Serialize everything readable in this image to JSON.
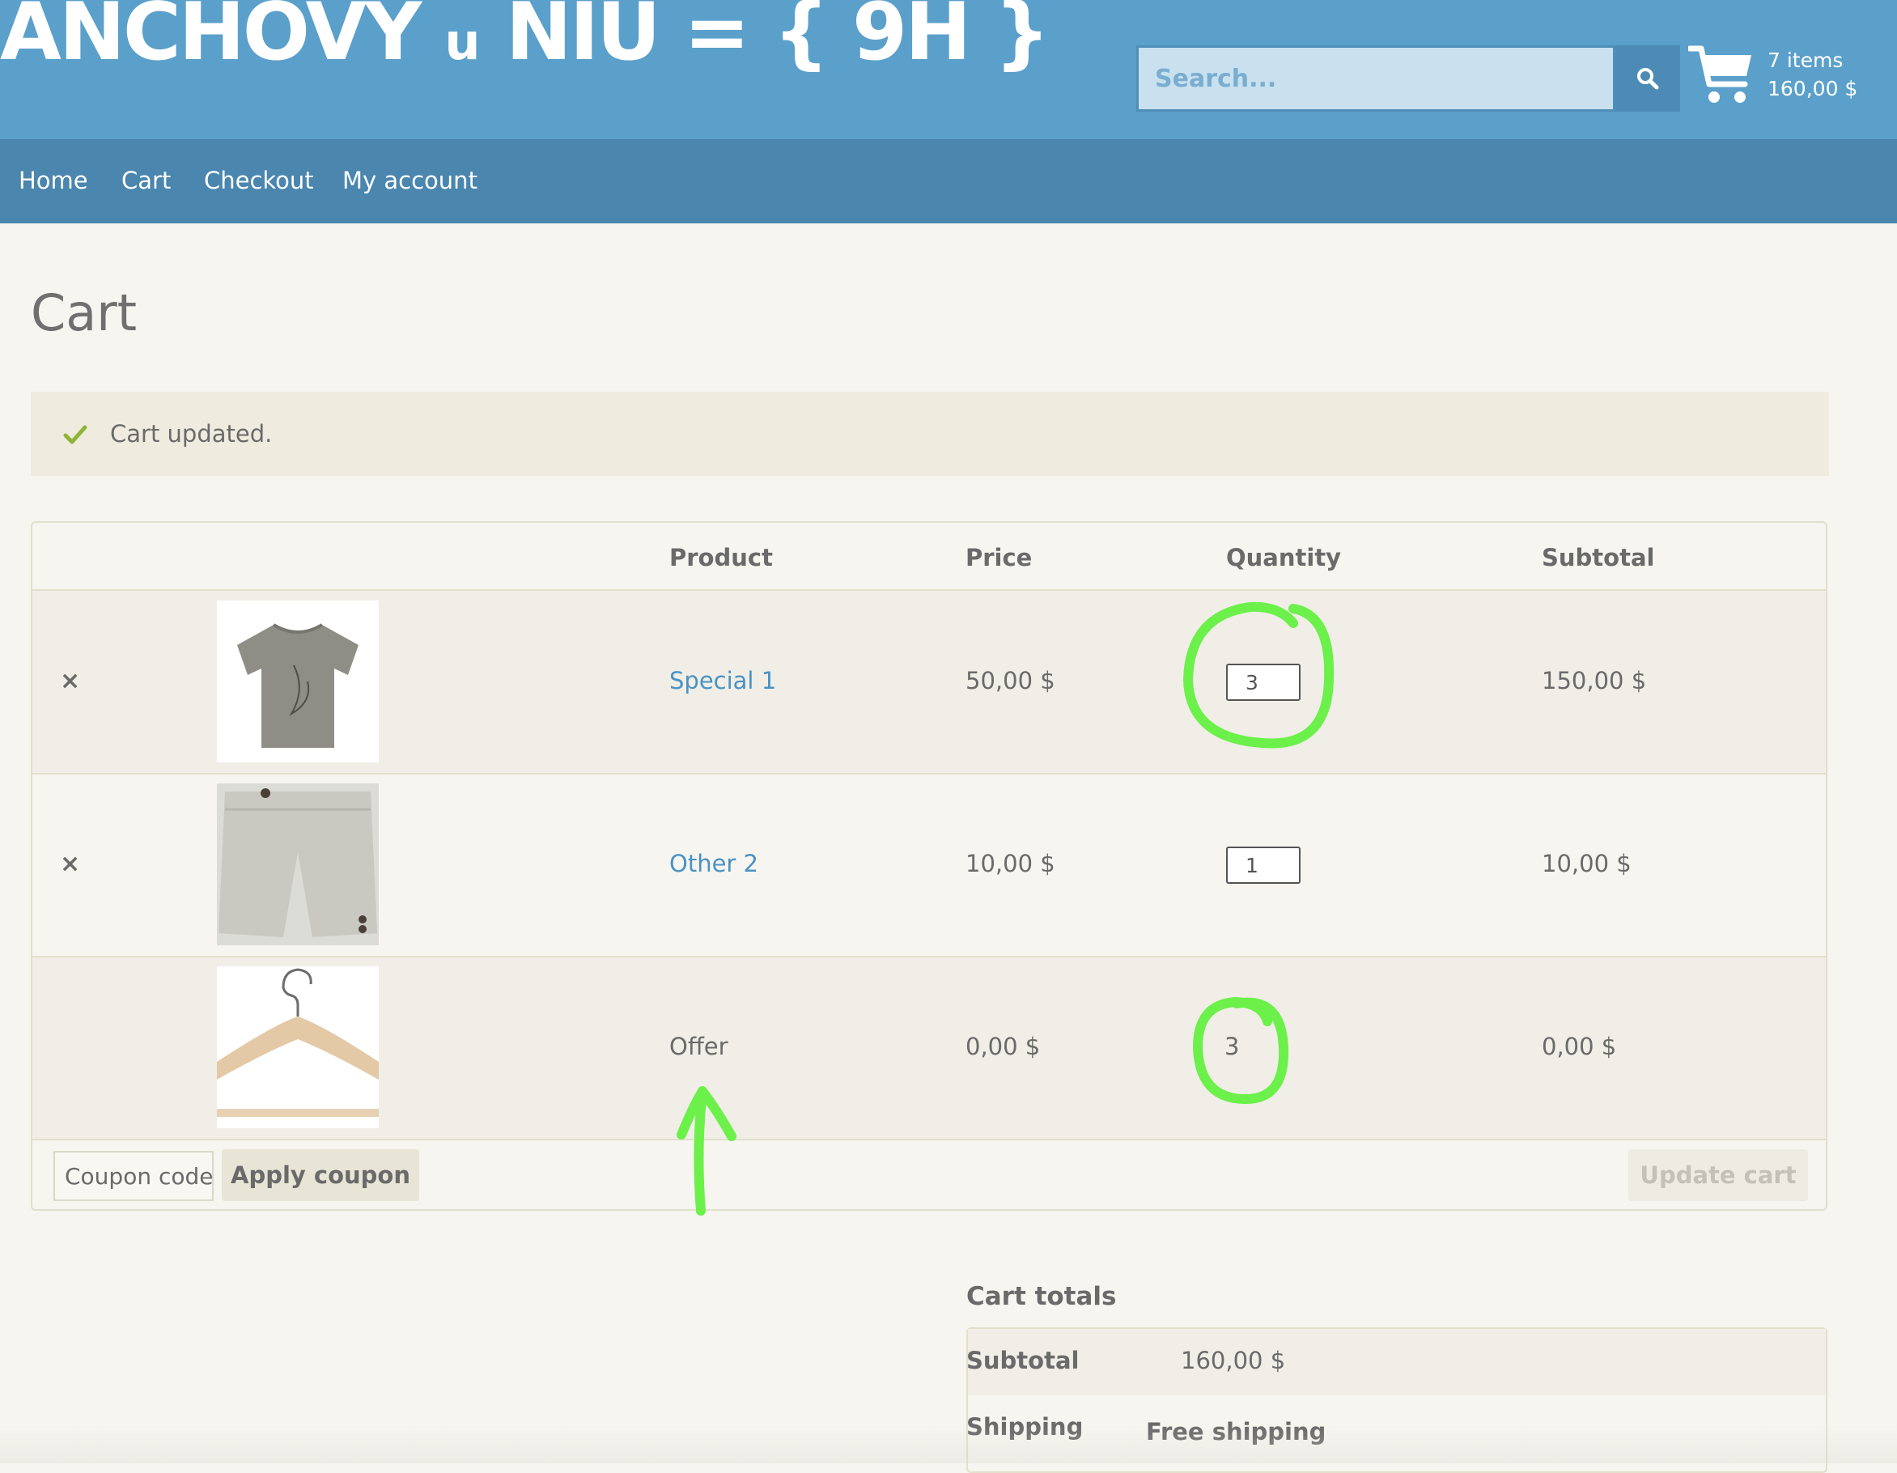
{
  "header": {
    "site_title_part1": "ANCHOVY",
    "site_title_part2": "u",
    "site_title_part3": "NIU = { 9H }",
    "search_placeholder": "Search...",
    "search_icon": "search-icon",
    "cart_icon": "cart-icon",
    "cart_count": "7 items",
    "cart_total": "160,00 $"
  },
  "nav": {
    "items": [
      "Home",
      "Cart",
      "Checkout",
      "My account"
    ]
  },
  "page": {
    "title": "Cart",
    "notice": "Cart updated.",
    "notice_icon": "check-icon"
  },
  "table": {
    "headers": [
      "Product",
      "Price",
      "Quantity",
      "Subtotal"
    ],
    "rows": [
      {
        "product": "Special 1",
        "price": "50,00 $",
        "quantity": "3",
        "subtotal": "150,00 $",
        "removable": true,
        "image": "grey-tshirt-image"
      },
      {
        "product": "Other 2",
        "price": "10,00 $",
        "quantity": "1",
        "subtotal": "10,00 $",
        "removable": true,
        "image": "grey-shorts-image"
      },
      {
        "product": "Offer",
        "price": "0,00 $",
        "quantity": "3",
        "subtotal": "0,00 $",
        "removable": false,
        "image": "wooden-hanger-image"
      }
    ],
    "remove_symbol": "×",
    "coupon_placeholder": "Coupon code",
    "apply_coupon": "Apply coupon",
    "update_cart": "Update cart"
  },
  "totals": {
    "title": "Cart totals",
    "subtotal_label": "Subtotal",
    "subtotal_value": "160,00 $",
    "shipping_label": "Shipping",
    "shipping_value": "Free shipping"
  },
  "colors": {
    "header_bg": "#5ba0cb",
    "nav_bg": "#4a86ae",
    "link": "#4b92c3",
    "annotation": "#6cf04a"
  }
}
